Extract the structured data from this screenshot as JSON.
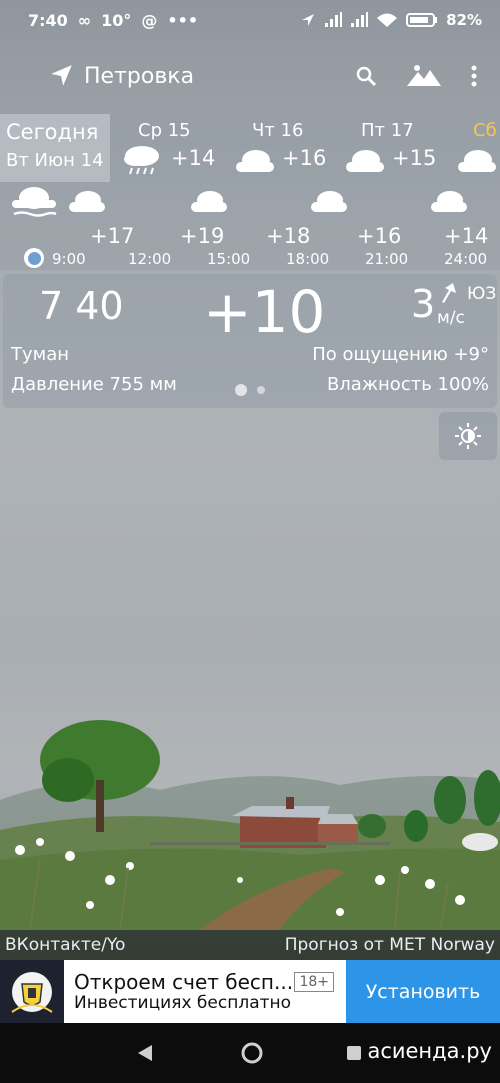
{
  "status_bar": {
    "time": "7:40",
    "indicators": [
      "∞",
      "10°",
      "@",
      "•••"
    ],
    "battery": "82%"
  },
  "app_bar": {
    "location": "Петровка",
    "icons": [
      "location-arrow-icon",
      "search-icon",
      "landscape-icon",
      "more-vert-icon"
    ]
  },
  "daily": {
    "today": {
      "label": "Сегодня",
      "date": "Вт Июн 14"
    },
    "days": [
      {
        "name": "Ср 15",
        "temp": "+14",
        "icon": "rain-cloud-icon"
      },
      {
        "name": "Чт 16",
        "temp": "+16",
        "icon": "cloud-icon"
      },
      {
        "name": "Пт 17",
        "temp": "+15",
        "icon": "cloud-icon"
      },
      {
        "name": "Сб",
        "temp": "",
        "icon": "cloud-icon",
        "highlight": "#f5c55a"
      }
    ]
  },
  "hourly": [
    {
      "time": "9:00",
      "temp": "",
      "icon": "fog-icon"
    },
    {
      "time": "12:00",
      "temp": "+17",
      "icon": "cloud-icon"
    },
    {
      "time": "15:00",
      "temp": "+19",
      "icon": "cloud-icon"
    },
    {
      "time": "18:00",
      "temp": "+18",
      "icon": "cloud-icon"
    },
    {
      "time": "21:00",
      "temp": "+16",
      "icon": "cloud-icon"
    },
    {
      "time": "24:00",
      "temp": "+14",
      "icon": "cloud-icon"
    }
  ],
  "current": {
    "time": "7 40",
    "temp": "+10",
    "wind_speed": "3",
    "wind_dir": "ЮЗ",
    "wind_unit": "м/с",
    "condition": "Туман",
    "feels_like": "По ощущению +9°",
    "pressure": "Давление 755 мм",
    "humidity": "Влажность 100%"
  },
  "credits": {
    "left": "ВКонтакте/Yo",
    "right": "Прогноз от MET Norway"
  },
  "ad": {
    "title": "Откроем счет бесп...",
    "subtitle": "Инвестициях бесплатно",
    "age": "18+",
    "button": "Установить"
  },
  "watermark": "асиенда.ру",
  "colors": {
    "accent_day": "#f5c55a",
    "ad_button": "#2c95e8",
    "now_dot": "#6d9fd0"
  }
}
